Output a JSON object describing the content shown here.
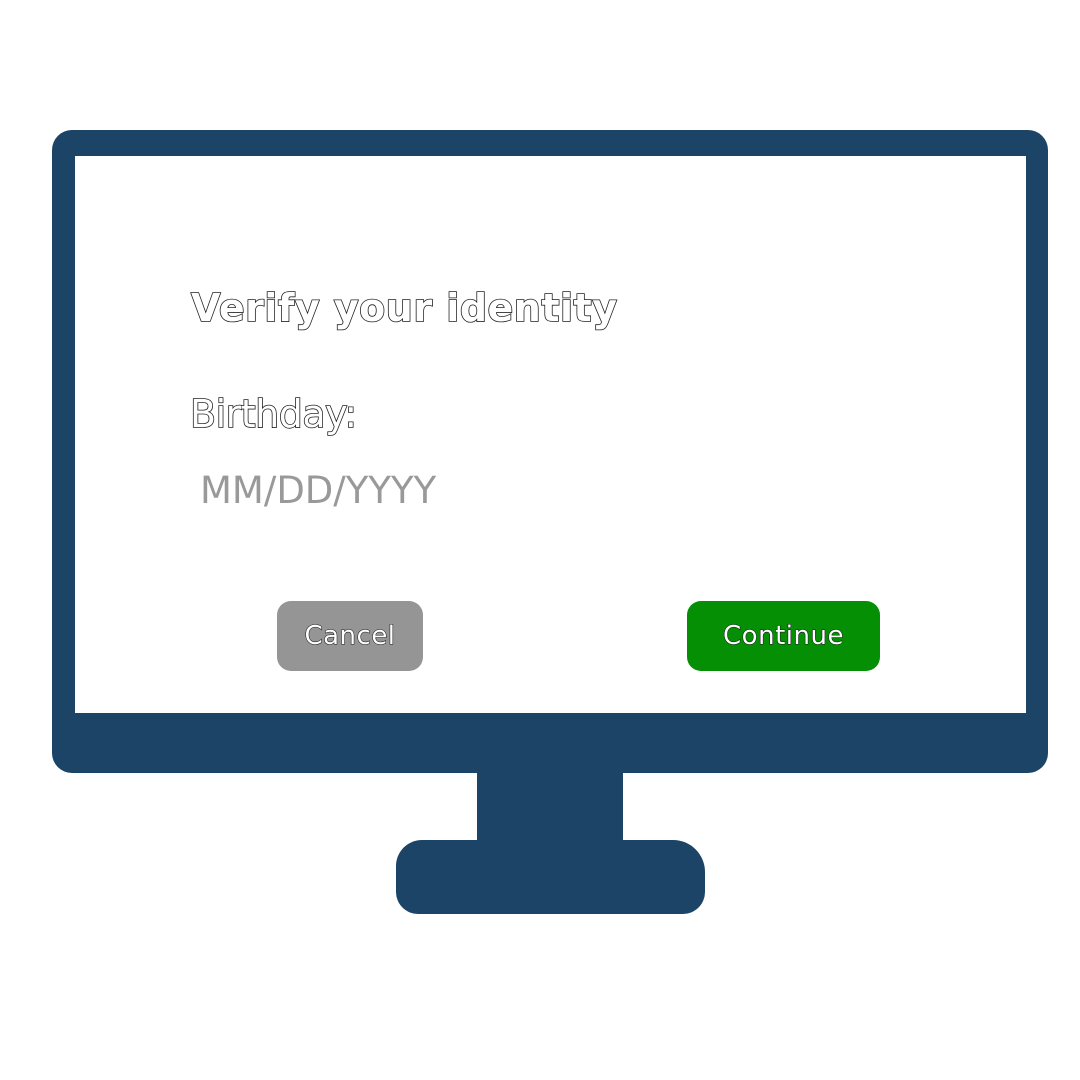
{
  "dialog": {
    "title": "Verify your identity",
    "birthday_label": "Birthday:",
    "birthday_placeholder": "MM/DD/YYYY",
    "birthday_value": "",
    "cancel_label": "Cancel",
    "continue_label": "Continue"
  },
  "colors": {
    "monitor": "#1b4466",
    "screen": "#ffffff",
    "cancel_button": "#959595",
    "continue_button": "#058f05",
    "placeholder_text": "#999999"
  }
}
